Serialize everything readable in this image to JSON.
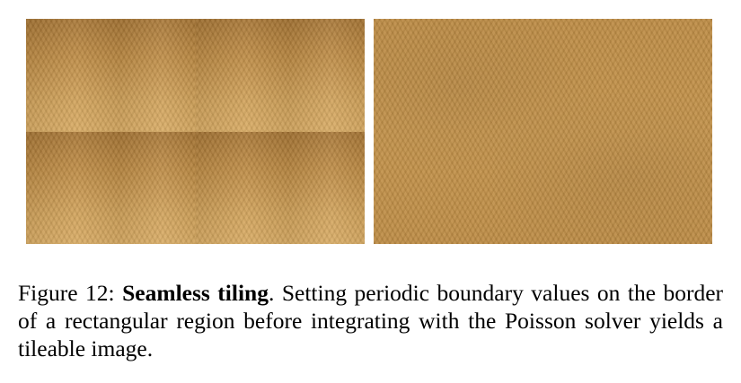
{
  "figure": {
    "label": "Figure 12:",
    "title": "Seamless tiling",
    "title_suffix": ".",
    "body": "Setting periodic boundary values on the border of a rectangular region before integrating with the Poisson solver yields a tileable image."
  },
  "colors": {
    "texture_dark": "#a87634",
    "texture_light": "#d9ab62",
    "texture_mid": "#c4934b"
  }
}
